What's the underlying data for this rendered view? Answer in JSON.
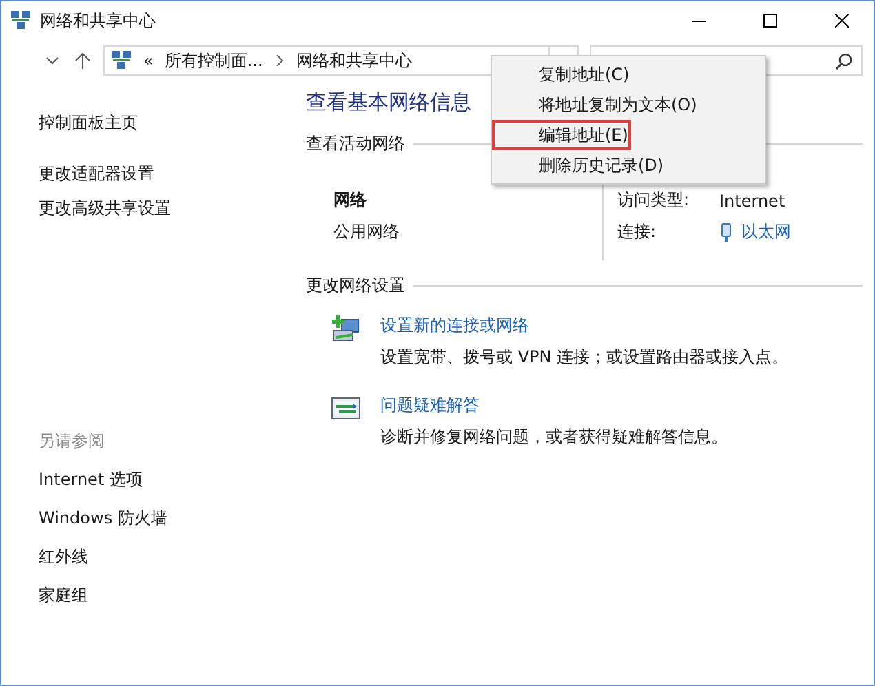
{
  "window": {
    "title": "网络和共享中心"
  },
  "address_bar": {
    "overflow": "«",
    "crumbs": [
      "所有控制面...",
      "网络和共享中心"
    ]
  },
  "context_menu": [
    {
      "label": "复制地址(C)",
      "highlighted": false
    },
    {
      "label": "将地址复制为文本(O)",
      "highlighted": false
    },
    {
      "label": "编辑地址(E)",
      "highlighted": true
    },
    {
      "label": "删除历史记录(D)",
      "highlighted": false
    }
  ],
  "sidebar": {
    "items": [
      "控制面板主页",
      "更改适配器设置",
      "更改高级共享设置"
    ],
    "see_also_title": "另请参阅",
    "see_also": [
      "Internet 选项",
      "Windows 防火墙",
      "红外线",
      "家庭组"
    ]
  },
  "main": {
    "heading": "查看基本网络信息",
    "active_title": "查看活动网络",
    "network": {
      "name": "网络",
      "type": "公用网络",
      "access_label": "访问类型:",
      "access_value": "Internet",
      "connection_label": "连接:",
      "connection_value": "以太网"
    },
    "settings_title": "更改网络设置",
    "tasks": [
      {
        "kind": "new-connection",
        "link": "设置新的连接或网络",
        "description": "设置宽带、拨号或 VPN 连接；或设置路由器或接入点。"
      },
      {
        "kind": "troubleshoot",
        "link": "问题疑难解答",
        "description": "诊断并修复网络问题，或者获得疑难解答信息。"
      }
    ]
  }
}
